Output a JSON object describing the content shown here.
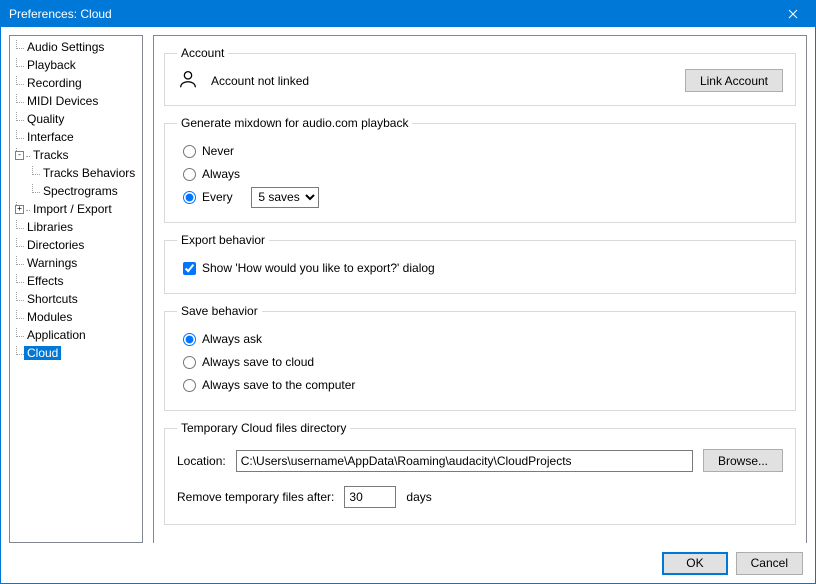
{
  "window": {
    "title": "Preferences: Cloud"
  },
  "sidebar": {
    "items": [
      {
        "label": "Audio Settings",
        "level": 1
      },
      {
        "label": "Playback",
        "level": 1
      },
      {
        "label": "Recording",
        "level": 1
      },
      {
        "label": "MIDI Devices",
        "level": 1
      },
      {
        "label": "Quality",
        "level": 1
      },
      {
        "label": "Interface",
        "level": 1
      },
      {
        "label": "Tracks",
        "level": 1,
        "expander": "-"
      },
      {
        "label": "Tracks Behaviors",
        "level": 2
      },
      {
        "label": "Spectrograms",
        "level": 2
      },
      {
        "label": "Import / Export",
        "level": 1,
        "expander": "+"
      },
      {
        "label": "Libraries",
        "level": 1
      },
      {
        "label": "Directories",
        "level": 1
      },
      {
        "label": "Warnings",
        "level": 1
      },
      {
        "label": "Effects",
        "level": 1
      },
      {
        "label": "Shortcuts",
        "level": 1
      },
      {
        "label": "Modules",
        "level": 1
      },
      {
        "label": "Application",
        "level": 1
      },
      {
        "label": "Cloud",
        "level": 1,
        "selected": true
      }
    ]
  },
  "account": {
    "legend": "Account",
    "status": "Account not linked",
    "link_button": "Link Account"
  },
  "mixdown": {
    "legend": "Generate mixdown for audio.com playback",
    "never": "Never",
    "always": "Always",
    "every": "Every",
    "every_value": "5 saves"
  },
  "export": {
    "legend": "Export behavior",
    "show_dialog": "Show 'How would you like to export?' dialog"
  },
  "save": {
    "legend": "Save behavior",
    "always_ask": "Always ask",
    "always_cloud": "Always save to cloud",
    "always_computer": "Always save to the computer"
  },
  "tempdir": {
    "legend": "Temporary Cloud files directory",
    "location_label": "Location:",
    "location_value": "C:\\Users\\username\\AppData\\Roaming\\audacity\\CloudProjects",
    "browse": "Browse...",
    "remove_label": "Remove temporary files after:",
    "remove_value": "30",
    "remove_unit": "days"
  },
  "footer": {
    "ok": "OK",
    "cancel": "Cancel"
  }
}
